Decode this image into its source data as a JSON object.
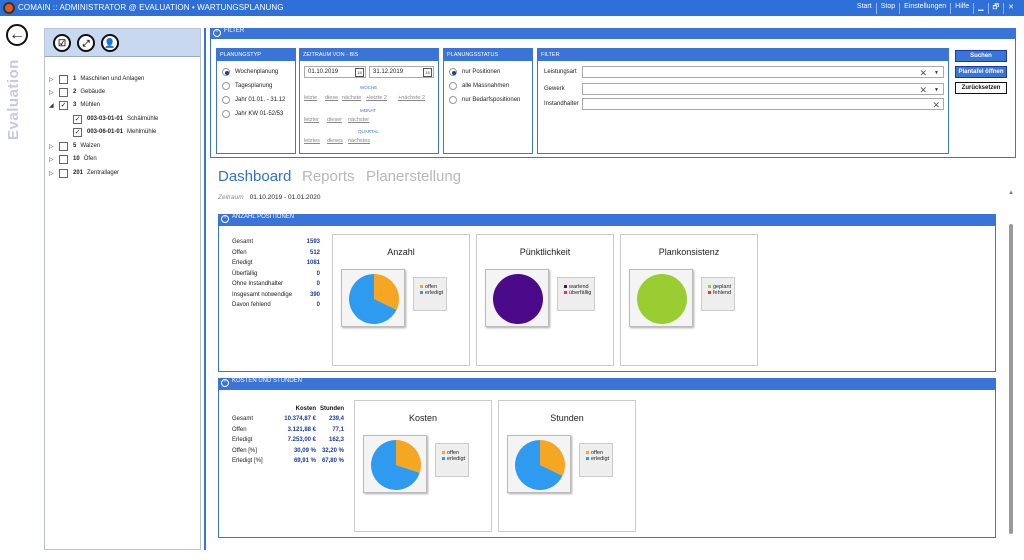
{
  "titlebar": {
    "title": "COMAIN :: ADMINISTRATOR @ EVALUATION • WARTUNGSPLANUNG",
    "menu": [
      "Start",
      "Stop",
      "Einstellungen",
      "Hilfe"
    ],
    "win": [
      "▁",
      "🗗",
      "✕"
    ]
  },
  "sidebar": {
    "vertical_label": "Evaluation",
    "back_icon": "arrow-left-icon"
  },
  "tree": {
    "toolbar_icons": [
      "check-all-icon",
      "expand-icon",
      "user-icon"
    ],
    "items": [
      {
        "arrow": "▷",
        "checked": false,
        "num": "1",
        "label": "Maschinen und Anlagen"
      },
      {
        "arrow": "▷",
        "checked": false,
        "num": "2",
        "label": "Gebäude"
      },
      {
        "arrow": "◢",
        "checked": true,
        "num": "3",
        "label": "Mühlen"
      },
      {
        "arrow": "",
        "checked": true,
        "num": "003-03-01-01",
        "label": "Schälmühle"
      },
      {
        "arrow": "",
        "checked": true,
        "num": "003-06-01-01",
        "label": "Mehlmühle"
      },
      {
        "arrow": "▷",
        "checked": false,
        "num": "5",
        "label": "Walzen"
      },
      {
        "arrow": "▷",
        "checked": false,
        "num": "10",
        "label": "Öfen"
      },
      {
        "arrow": "▷",
        "checked": false,
        "num": "201",
        "label": "Zentrallager"
      }
    ]
  },
  "filter": {
    "header": "FILTER",
    "planungstyp": {
      "title": "PLANUNGSTYP",
      "options": [
        "Wochenplanung",
        "Tagesplanung",
        "Jahr 01.01. - 31.12",
        "Jahr KW 01-52/53"
      ],
      "selected": 0
    },
    "zeitraum": {
      "title": "ZEITRAUM VON - BIS",
      "from": "01.10.2019",
      "to": "31.12.2019",
      "cal": "15",
      "woche_label": "WOCHE",
      "woche_links": [
        "letzte",
        "diese",
        "nächste",
        "+letzte 2",
        "+nächste 2"
      ],
      "monat_label": "MONAT",
      "monat_links": [
        "letzter",
        "dieser",
        "nächster"
      ],
      "quartal_label": "QUARTAL",
      "quartal_links": [
        "letztes",
        "dieses",
        "nächstes"
      ]
    },
    "planungsstatus": {
      "title": "PLANUNGSSTATUS",
      "options": [
        "nur Positionen",
        "alle Massnahmen",
        "nur Bedarfspositionen"
      ],
      "selected": 0
    },
    "filter2": {
      "title": "FILTER",
      "fields": [
        "Leistungsart",
        "Gewerk",
        "Instandhalter"
      ]
    },
    "buttons": {
      "search": "Suchen",
      "plantafel": "Plantafel öffnen",
      "reset": "Zurücksetzen"
    }
  },
  "tabs": {
    "dashboard": "Dashboard",
    "reports": "Reports",
    "planer": "Planerstellung",
    "colors": {
      "active": "#2f6fd8",
      "inactive": "#b8b8b8"
    }
  },
  "zeitraum": {
    "label": "Zeitraum",
    "value": "01.10.2019 - 01.01.2020"
  },
  "anzahl": {
    "header": "ANZAHL POSITIONEN",
    "stats": [
      [
        "Gesamt",
        "1593"
      ],
      [
        "Offen",
        "512"
      ],
      [
        "Erledigt",
        "1081"
      ],
      [
        "Überfällig",
        "0"
      ],
      [
        "Ohne Instandhalter",
        "0"
      ],
      [
        "Insgesamt notwendige",
        "390"
      ],
      [
        "Davon fehlend",
        "0"
      ]
    ],
    "cards": [
      {
        "title": "Anzahl",
        "legend": [
          {
            "label": "offen",
            "color": "#f5a623"
          },
          {
            "label": "erledigt",
            "color": "#2f9bf0"
          }
        ]
      },
      {
        "title": "Pünktlichkeit",
        "legend": [
          {
            "label": "wartend",
            "color": "#4a0a8a"
          },
          {
            "label": "überfällig",
            "color": "#e53935"
          }
        ]
      },
      {
        "title": "Plankonsistenz",
        "legend": [
          {
            "label": "geplant",
            "color": "#9acd32"
          },
          {
            "label": "fehlend",
            "color": "#e53935"
          }
        ]
      }
    ]
  },
  "kosten": {
    "header": "KOSTEN UND STUNDEN",
    "cols": [
      "",
      "Kosten",
      "Stunden"
    ],
    "rows": [
      [
        "Gesamt",
        "10.374,87 €",
        "239,4"
      ],
      [
        "Offen",
        "3.121,88 €",
        "77,1"
      ],
      [
        "Erledigt",
        "7.253,00 €",
        "162,3"
      ],
      [
        "Offen [%]",
        "30,09 %",
        "32,20 %"
      ],
      [
        "Erledigt [%]",
        "69,91 %",
        "67,80 %"
      ]
    ],
    "cards": [
      {
        "title": "Kosten",
        "legend": [
          {
            "label": "offen",
            "color": "#f5a623"
          },
          {
            "label": "erledigt",
            "color": "#2f9bf0"
          }
        ]
      },
      {
        "title": "Stunden",
        "legend": [
          {
            "label": "offen",
            "color": "#f5a623"
          },
          {
            "label": "erledigt",
            "color": "#2f9bf0"
          }
        ]
      }
    ]
  },
  "chart_data": [
    {
      "type": "pie",
      "title": "Anzahl",
      "categories": [
        "offen",
        "erledigt"
      ],
      "values": [
        512,
        1081
      ]
    },
    {
      "type": "pie",
      "title": "Pünktlichkeit",
      "categories": [
        "wartend",
        "überfällig"
      ],
      "values": [
        1,
        0
      ]
    },
    {
      "type": "pie",
      "title": "Plankonsistenz",
      "categories": [
        "geplant",
        "fehlend"
      ],
      "values": [
        1,
        0
      ]
    },
    {
      "type": "pie",
      "title": "Kosten",
      "categories": [
        "offen",
        "erledigt"
      ],
      "values": [
        3121.88,
        7253.0
      ]
    },
    {
      "type": "pie",
      "title": "Stunden",
      "categories": [
        "offen",
        "erledigt"
      ],
      "values": [
        77.1,
        162.3
      ]
    }
  ]
}
